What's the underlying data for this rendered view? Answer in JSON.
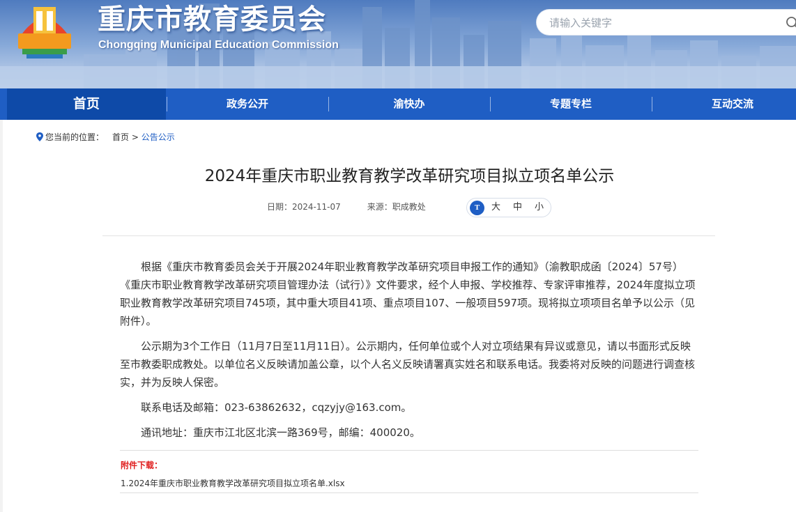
{
  "header": {
    "site_title": "重庆市教育委员会",
    "site_subtitle": "Chongqing Municipal Education Commission",
    "search_placeholder": "请输入关键字"
  },
  "nav": {
    "items": [
      {
        "label": "首页",
        "active": true
      },
      {
        "label": "政务公开",
        "active": false
      },
      {
        "label": "渝快办",
        "active": false
      },
      {
        "label": "专题专栏",
        "active": false
      },
      {
        "label": "互动交流",
        "active": false
      }
    ]
  },
  "breadcrumb": {
    "prefix": "您当前的位置：",
    "home": "首页",
    "separator": ">",
    "current": "公告公示"
  },
  "article": {
    "title": "2024年重庆市职业教育教学改革研究项目拟立项名单公示",
    "date_label": "日期：2024-11-07",
    "source_label": "来源：职成教处",
    "font_size": {
      "icon_text": "T",
      "large": "大",
      "medium": "中",
      "small": "小"
    },
    "paragraphs": [
      "根据《重庆市教育委员会关于开展2024年职业教育教学改革研究项目申报工作的通知》（渝教职成函〔2024〕57号）《重庆市职业教育教学改革研究项目管理办法（试行）》文件要求，经个人申报、学校推荐、专家评审推荐，2024年度拟立项职业教育教学改革研究项目745项，其中重大项目41项、重点项目107、一般项目597项。现将拟立项项目名单予以公示（见附件）。",
      "公示期为3个工作日（11月7日至11月11日）。公示期内，任何单位或个人对立项结果有异议或意见，请以书面形式反映至市教委职成教处。以单位名义反映请加盖公章，以个人名义反映请署真实姓名和联系电话。我委将对反映的问题进行调查核实，并为反映人保密。",
      "联系电话及邮箱：023-63862632，cqzyjy@163.com。",
      "通讯地址：重庆市江北区北滨一路369号，邮编：400020。"
    ],
    "attachments_label": "附件下载：",
    "attachments": [
      "1.2024年重庆市职业教育教学改革研究项目拟立项名单.xlsx"
    ]
  },
  "colors": {
    "nav_bg": "#1f5ec4",
    "nav_active": "#0e4aa8",
    "link_blue": "#1f5ec4",
    "attach_red": "#e02020"
  }
}
